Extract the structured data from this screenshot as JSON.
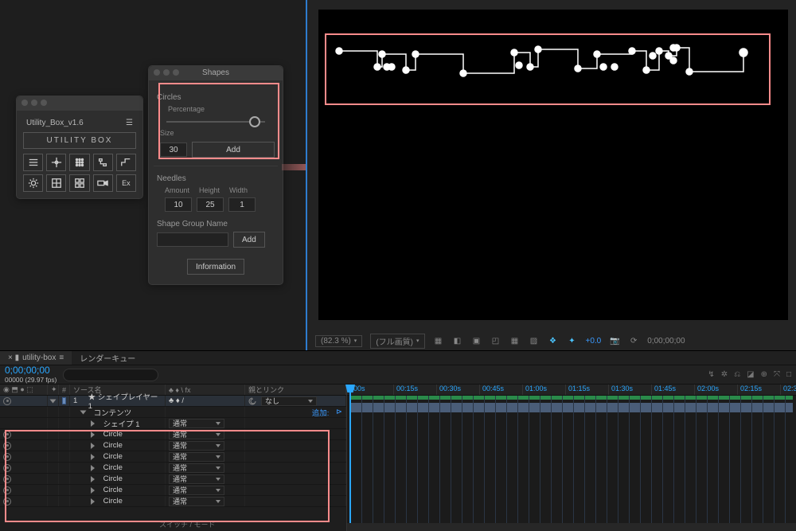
{
  "util_panel": {
    "title": "Utility_Box_v1.6",
    "logo": "UTILITY BOX",
    "ex_label": "Ex"
  },
  "shapes_panel": {
    "title": "Shapes",
    "circles": {
      "title": "Circles",
      "percentage_label": "Percentage",
      "size_label": "Size",
      "size_value": "30",
      "add_label": "Add"
    },
    "needles": {
      "title": "Needles",
      "amount_label": "Amount",
      "height_label": "Height",
      "width_label": "Width",
      "amount_value": "10",
      "height_value": "25",
      "width_value": "1"
    },
    "group": {
      "title": "Shape Group Name",
      "add_label": "Add"
    },
    "info_label": "Information"
  },
  "viewer_footer": {
    "zoom": "(82.3 %)",
    "quality": "(フル画質)",
    "exposure": "+0.0",
    "time": "0;00;00;00"
  },
  "timeline": {
    "tab_active": "utility-box",
    "tab_render": "レンダーキュー",
    "timecode": "0;00;00;00",
    "framecount": "00000 (29.97 fps)",
    "cols": {
      "vis": "",
      "source": "ソース名",
      "fx": "♣ ♦ \\ fx",
      "parent": "親とリンク"
    },
    "layer1": {
      "num": "1",
      "name": "★ シェイプレイヤー 1",
      "fx": "♣ ♦  /",
      "parent_none": "なし"
    },
    "contents": "コンテンツ",
    "add": "追加:",
    "shape1": "シェイプ 1",
    "circle": "Circle",
    "mode_normal": "通常",
    "switch_label": "スイッチ / モード",
    "ruler_ticks": [
      "00s",
      "00:15s",
      "00:30s",
      "00:45s",
      "01:00s",
      "01:15s",
      "01:30s",
      "01:45s",
      "02:00s",
      "02:15s",
      "02:3"
    ]
  }
}
